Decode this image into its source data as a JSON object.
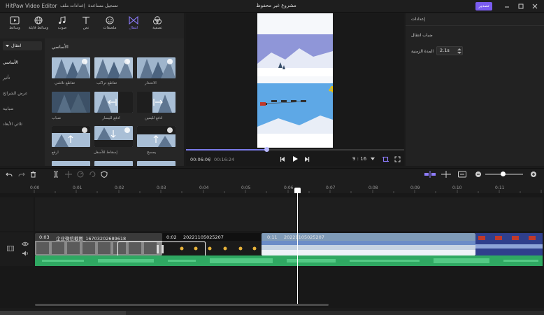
{
  "titlebar": {
    "app_name": "HitPaw Video Editor",
    "menus": [
      "ملف",
      "إعدادات",
      "مساعدة",
      "تسجيل"
    ],
    "project_title": "مشروع غير محفوظ",
    "export_label": "تصدير"
  },
  "toolbar": {
    "tools": [
      {
        "label": "وسائط",
        "icon": "media-icon"
      },
      {
        "label": "وسائط قابلة",
        "icon": "globe-icon"
      },
      {
        "label": "صوت",
        "icon": "music-icon"
      },
      {
        "label": "نص",
        "icon": "text-icon"
      },
      {
        "label": "ملصقات",
        "icon": "sticker-icon"
      },
      {
        "label": "انتقال",
        "icon": "transition-icon"
      },
      {
        "label": "تصفية",
        "icon": "filter-icon"
      }
    ],
    "active_index": 5,
    "accent": "#8e7cff"
  },
  "sidebar": {
    "header": "انتقال",
    "items": [
      "الأساسي",
      "تأثير",
      "عرض الشرائح",
      "ضبابية",
      "ثلاثي الأبعاد"
    ],
    "active_index": 0
  },
  "grid": {
    "title": "الأساسي",
    "items": [
      {
        "label": "تقاطع تلاشي"
      },
      {
        "label": "تقاطع تراكب"
      },
      {
        "label": "الانحدار"
      },
      {
        "label": "ضباب"
      },
      {
        "label": "ادفع لليسار"
      },
      {
        "label": "ادفع لليمين"
      },
      {
        "label": "ارفع"
      },
      {
        "label": "إسقاط للأسفل"
      },
      {
        "label": "يمسح"
      }
    ]
  },
  "preview": {
    "time_current": "00:06:06",
    "time_separator": "/",
    "time_total": "00:16:24",
    "aspect_ratio": "9 : 16",
    "progress": 0.37,
    "counter_text": "4"
  },
  "properties": {
    "title": "إعدادات",
    "transition_name": "ضباب انتقال",
    "duration_label": "المدة الزمنية",
    "duration_value": "2.1s"
  },
  "timeline": {
    "ticks": [
      "0:00",
      "0:01",
      "0:02",
      "0:03",
      "0:04",
      "0:05",
      "0:06",
      "0:07",
      "0:08",
      "0:09",
      "0:10",
      "0:11"
    ],
    "clips": [
      {
        "duration": "0:03",
        "name": "企业微信截图_16703202689618"
      },
      {
        "duration": "0:02",
        "name": "20221105025207"
      },
      {
        "duration": "0:11",
        "name": "20221105025207"
      }
    ],
    "audio_color": "#2fa862"
  }
}
